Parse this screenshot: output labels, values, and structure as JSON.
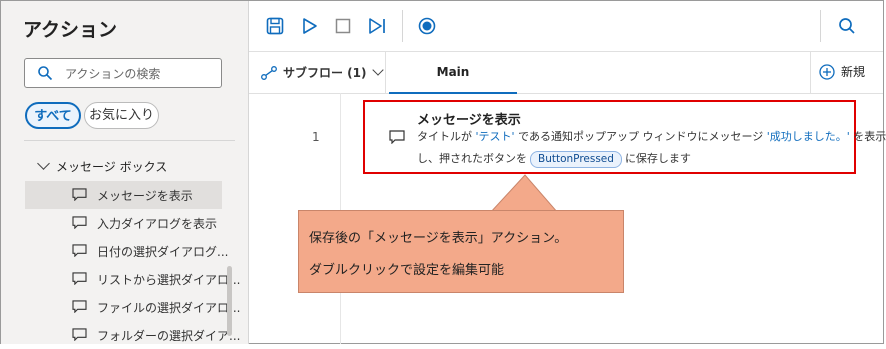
{
  "left_panel": {
    "title": "アクション",
    "search_placeholder": "アクションの検索",
    "filters": {
      "all": "すべて",
      "favorites": "お気に入り"
    },
    "group": "メッセージ ボックス",
    "items": [
      {
        "label": "メッセージを表示",
        "selected": true
      },
      {
        "label": "入力ダイアログを表示"
      },
      {
        "label": "日付の選択ダイアログ..."
      },
      {
        "label": "リストから選択ダイアロ..."
      },
      {
        "label": "ファイルの選択ダイアロ..."
      },
      {
        "label": "フォルダーの選択ダイア..."
      }
    ]
  },
  "toolbar": {
    "icons": [
      "save-icon",
      "run-icon",
      "stop-icon",
      "step-icon",
      "record-icon",
      "search-icon"
    ]
  },
  "tabs": {
    "subflow": "サブフロー (1)",
    "main": "Main",
    "new": "新規"
  },
  "action": {
    "line_number": "1",
    "title": "メッセージを表示",
    "desc_pre": "タイトルが",
    "desc_title_val": "'テスト'",
    "desc_mid": "である通知ポップアップ ウィンドウにメッセージ",
    "desc_msg_val": "'成功しました。'",
    "desc_end1": "を表示",
    "desc_line2_pre": "し、押されたボタンを",
    "variable": "ButtonPressed",
    "desc_line2_post": "に保存します"
  },
  "callout": {
    "line1": "保存後の「メッセージを表示」アクション。",
    "line2": "ダブルクリックで設定を編集可能"
  },
  "colors": {
    "accent": "#0f6cbd",
    "highlight_border": "#e00000",
    "callout_fill": "#f3a98a"
  }
}
